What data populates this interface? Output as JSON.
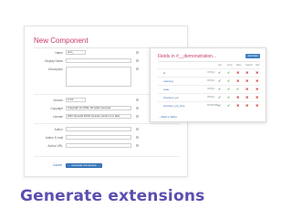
{
  "form": {
    "title": "New Component",
    "labels": {
      "name": "Name",
      "display_name": "Display Name",
      "description": "Description",
      "version": "Version",
      "copyright": "Copyright",
      "license": "License",
      "author": "Author",
      "author_email": "Author E-mail",
      "author_url": "Author URL"
    },
    "values": {
      "name": "com_",
      "display_name": "",
      "description": "",
      "version": "1.0.0",
      "copyright": "Copyright (C) 2011. All rights reserved.",
      "license": "GNU General Public License version 2 or later",
      "author": "",
      "author_email": "",
      "author_url": ""
    },
    "cancel_label": "Cancel",
    "generate_label": "Generate Component"
  },
  "fields_panel": {
    "title": "Fields in #__demonstration...",
    "add_label": "Add Field",
    "headers": [
      "List",
      "Form",
      "Filter",
      "Search",
      "Null"
    ],
    "rows": [
      {
        "name": "id",
        "type": "INT(11)",
        "cells": [
          "ok",
          "ok",
          "no",
          "no",
          "no"
        ]
      },
      {
        "name": "ordering",
        "type": "INT(11)",
        "cells": [
          "ok",
          "ok",
          "no",
          "no",
          "no"
        ]
      },
      {
        "name": "state",
        "type": "INT(11)",
        "cells": [
          "ok",
          "ok",
          "ok",
          "no",
          "no"
        ]
      },
      {
        "name": "checked_out",
        "type": "INT(11)",
        "cells": [
          "ok",
          "ok",
          "no",
          "no",
          "no"
        ]
      },
      {
        "name": "checked_out_time",
        "type": "DATETIME",
        "cells": [
          "ok",
          "ok",
          "no",
          "no",
          "no"
        ]
      }
    ],
    "footer": "« Back to Tables"
  },
  "slide_title": "Generate extensions",
  "colors": {
    "accent": "#c53a6b",
    "button": "#3f7fc2",
    "title": "#5a4fb0"
  }
}
